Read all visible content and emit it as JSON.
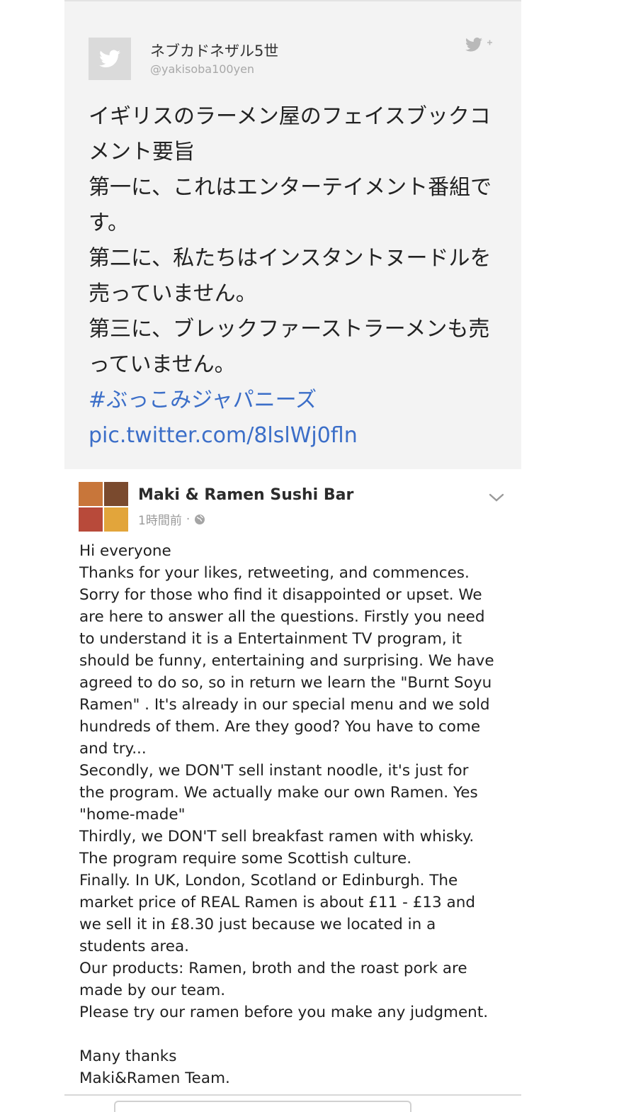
{
  "tweet": {
    "author_name": "ネブカドネザル5世",
    "handle": "@yakisoba100yen",
    "avatar_icon": "twitter-bird-icon",
    "follow_icon": "twitter-follow-icon",
    "text_lines": [
      "イギリスのラーメン屋のフェイスブックコ",
      "メント要旨",
      "第一に、これはエンターテイメント番組で",
      "す。",
      "第二に、私たちはインスタントヌードルを",
      "売っていません。",
      "第三に、ブレックファーストラーメンも売",
      "っていません。"
    ],
    "hashtag": "#ぶっこみジャパニーズ",
    "link": "pic.twitter.com/8lslWj0fln",
    "link_color": "#3b6ec8"
  },
  "facebook_post": {
    "page_name": "Maki & Ramen Sushi Bar",
    "timestamp": "1時間前",
    "privacy_icon": "globe-icon",
    "menu_icon": "chevron-down-icon",
    "body_lines": [
      "Hi everyone",
      "Thanks for your likes, retweeting, and commences.",
      "Sorry for those who find it disappointed or upset. We",
      "are here to answer all the questions. Firstly you need",
      "to understand it is a Entertainment TV program, it",
      "should be funny, entertaining and surprising. We have",
      "agreed to do so, so in return we learn the \"Burnt Soyu",
      "Ramen\" . It's already in our special menu and we sold",
      "hundreds of them. Are they good? You have to come",
      "and try...",
      "Secondly, we DON'T sell instant noodle, it's just for",
      "the program. We actually make our own Ramen. Yes",
      "\"home-made\"",
      "Thirdly, we DON'T sell breakfast ramen with whisky.",
      "The program require some Scottish culture.",
      "Finally. In UK, London, Scotland or Edinburgh. The",
      "market price of REAL Ramen is about £11 - £13 and",
      "we sell it in £8.30 just because we located in a",
      "students area.",
      "Our products: Ramen, broth and the roast pork are",
      "made by our team.",
      "Please try our ramen before you make any judgment.",
      "",
      "Many thanks",
      "Maki&Ramen Team."
    ]
  }
}
